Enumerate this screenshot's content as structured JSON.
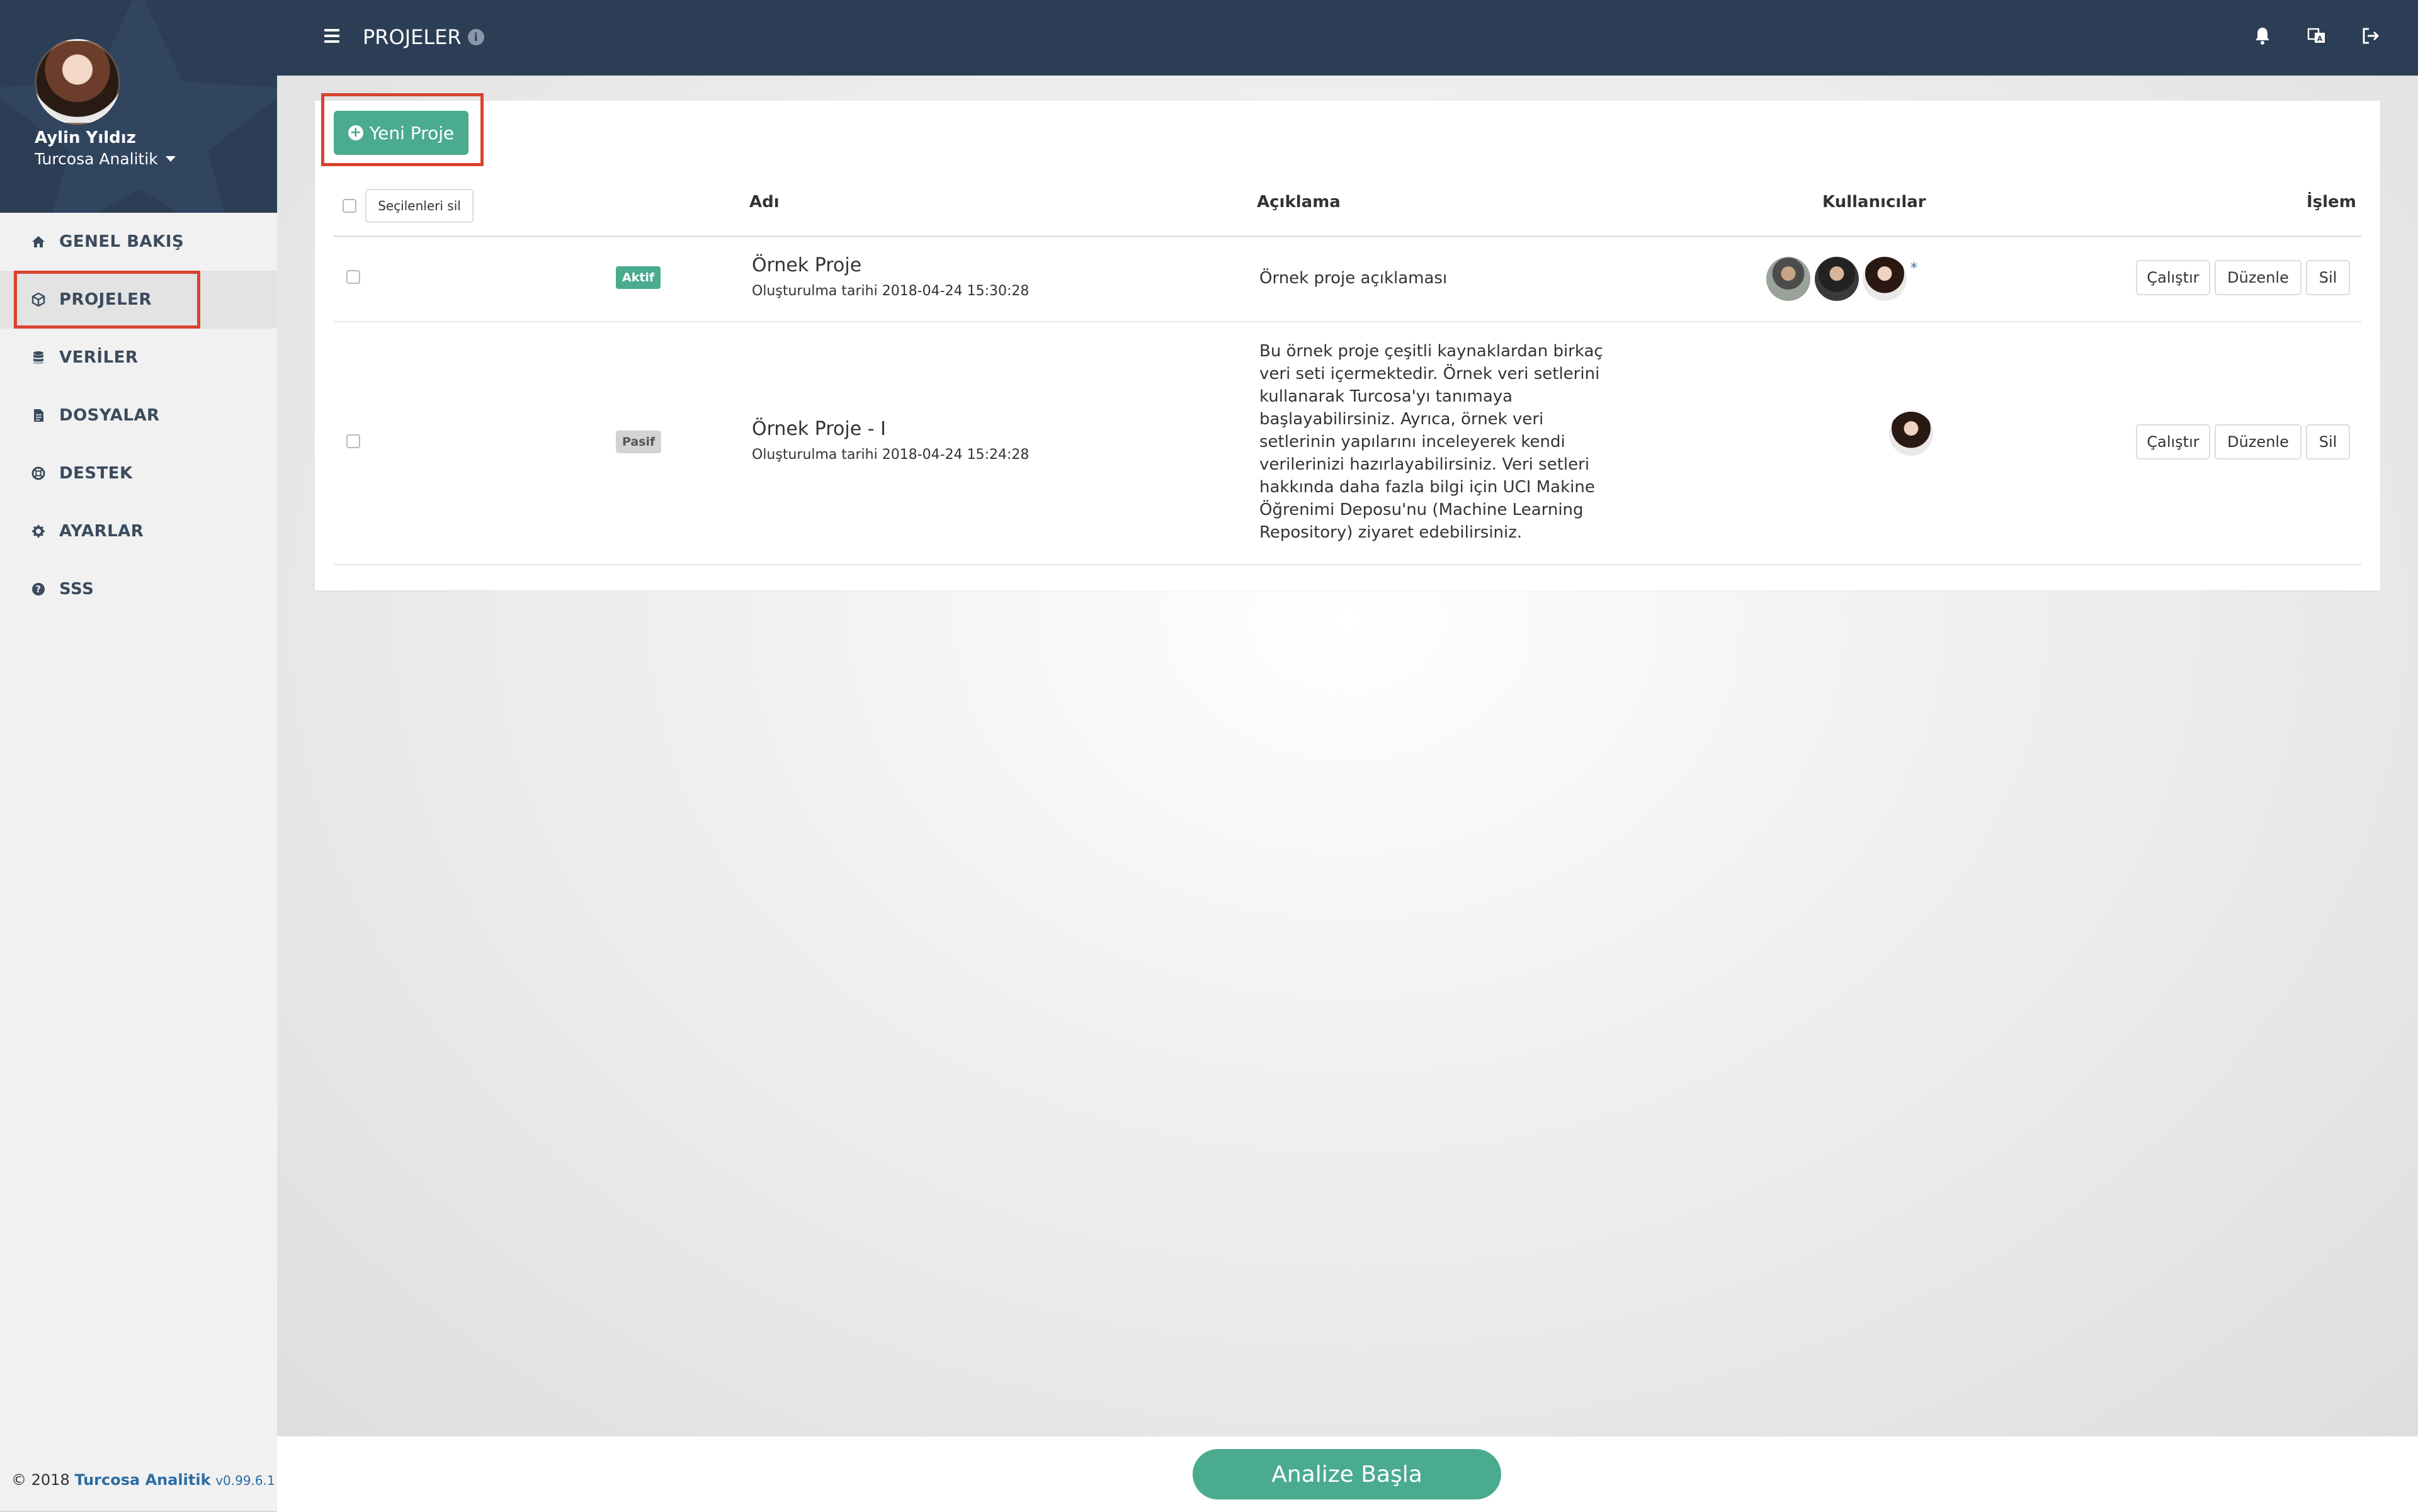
{
  "user": {
    "name": "Aylin Yıldız",
    "organization": "Turcosa Analitik"
  },
  "sidebar": {
    "items": [
      {
        "label": "GENEL BAKIŞ",
        "icon": "home-icon"
      },
      {
        "label": "PROJELER",
        "icon": "cube-icon",
        "active": true
      },
      {
        "label": "VERİLER",
        "icon": "database-icon"
      },
      {
        "label": "DOSYALAR",
        "icon": "file-icon"
      },
      {
        "label": "DESTEK",
        "icon": "lifebuoy-icon"
      },
      {
        "label": "AYARLAR",
        "icon": "gear-icon"
      },
      {
        "label": "SSS",
        "icon": "question-icon"
      }
    ]
  },
  "footer": {
    "copyright": "© 2018",
    "brand": "Turcosa Analitik",
    "version": "v0.99.6.1"
  },
  "header": {
    "title": "PROJELER",
    "info_icon": "i",
    "icons": [
      "bell-icon",
      "language-icon",
      "logout-icon"
    ]
  },
  "toolbar": {
    "new_project_label": "Yeni Proje",
    "delete_selected_label": "Seçilenleri sil"
  },
  "table": {
    "columns": [
      "Adı",
      "Açıklama",
      "Kullanıcılar",
      "İşlem"
    ],
    "rows": [
      {
        "status": "Aktif",
        "name": "Örnek Proje",
        "created": "Oluşturulma tarihi 2018-04-24 15:30:28",
        "description": "Örnek proje açıklaması",
        "users": 3,
        "owner_mark": "*",
        "actions": [
          "Çalıştır",
          "Düzenle",
          "Sil"
        ]
      },
      {
        "status": "Pasif",
        "name": "Örnek Proje - I",
        "created": "Oluşturulma tarihi 2018-04-24 15:24:28",
        "description": "Bu örnek proje çeşitli kaynaklardan birkaç veri seti içermektedir. Örnek veri setlerini kullanarak Turcosa'yı tanımaya başlayabilirsiniz. Ayrıca, örnek veri setlerinin yapılarını inceleyerek kendi verilerinizi hazırlayabilirsiniz. Veri setleri hakkında daha fazla bilgi için UCI Makine Öğrenimi Deposu'nu (Machine Learning Repository) ziyaret edebilirsiniz.",
        "users": 1,
        "actions": [
          "Çalıştır",
          "Düzenle",
          "Sil"
        ]
      }
    ]
  },
  "bottom": {
    "start_label": "Analize Başla"
  },
  "colors": {
    "navy": "#2c3e55",
    "accent_green": "#4aab8f",
    "highlight_red": "#d9432f"
  }
}
